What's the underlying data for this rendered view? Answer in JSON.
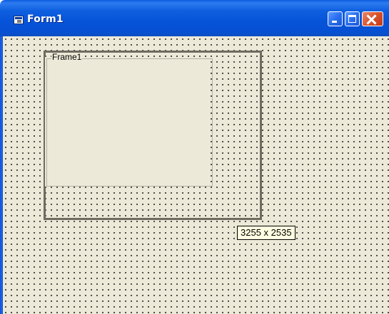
{
  "window": {
    "title": "Form1",
    "icon": "form-icon",
    "buttons": {
      "minimize": "minimize-icon",
      "maximize": "maximize-icon",
      "close": "close-icon"
    }
  },
  "designer": {
    "frame": {
      "caption": "Frame1"
    },
    "size_tooltip": "3255 x 2535"
  },
  "colors": {
    "titlebar": "#0753d8",
    "client": "#ece9d8",
    "tooltip": "#ffffe1",
    "close_button": "#d9532d"
  }
}
